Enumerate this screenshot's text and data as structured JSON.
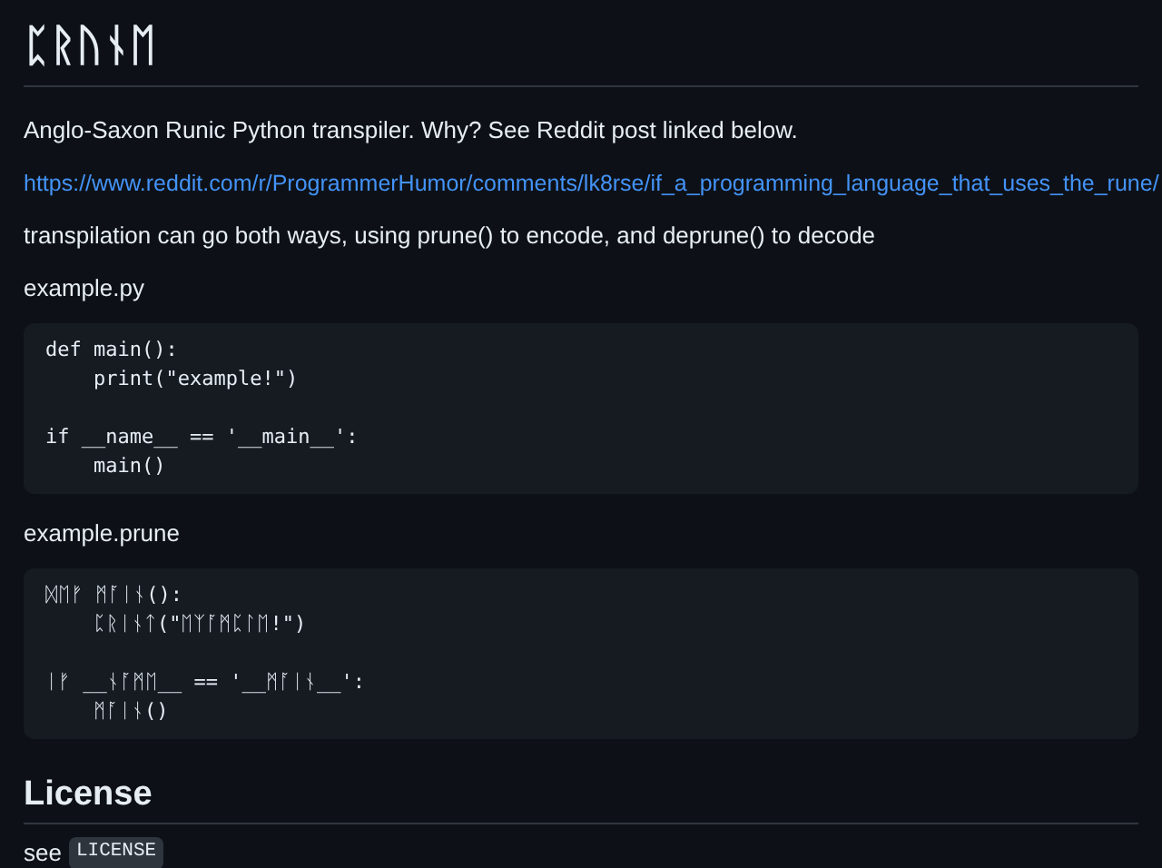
{
  "title": "ᛈᚱᚢᚾᛖ",
  "blocks": [
    {
      "kind": "text",
      "text": "Anglo-Saxon Runic Python transpiler. Why? See Reddit post linked below."
    },
    {
      "kind": "link",
      "text": "https://www.reddit.com/r/ProgrammerHumor/comments/lk8rse/if_a_programming_language_that_uses_the_rune/"
    },
    {
      "kind": "text",
      "text": "transpilation can go both ways, using prune() to encode, and deprune() to decode"
    },
    {
      "kind": "text",
      "text": "example.py"
    },
    {
      "kind": "code",
      "groups": [
        [
          "def main():",
          "    print(\"example!\")"
        ],
        [
          "if __name__ == '__main__':",
          "    main()"
        ]
      ]
    },
    {
      "kind": "text",
      "text": "example.prune"
    },
    {
      "kind": "code",
      "groups": [
        [
          "ᛞᛖᚠ ᛗᚪᛁᚾ():",
          "    ᛈᚱᛁᚾᛏ(\"ᛖᛉᚪᛗᛈᛚᛖ!\")"
        ],
        [
          "ᛁᚠ __ᚾᚪᛗᛖ__ == '__ᛗᚪᛁᚾ__':",
          "    ᛗᚪᛁᚾ()"
        ]
      ]
    },
    {
      "kind": "heading",
      "text": "License"
    },
    {
      "kind": "inline",
      "text": "see",
      "code": "LICENSE"
    }
  ]
}
